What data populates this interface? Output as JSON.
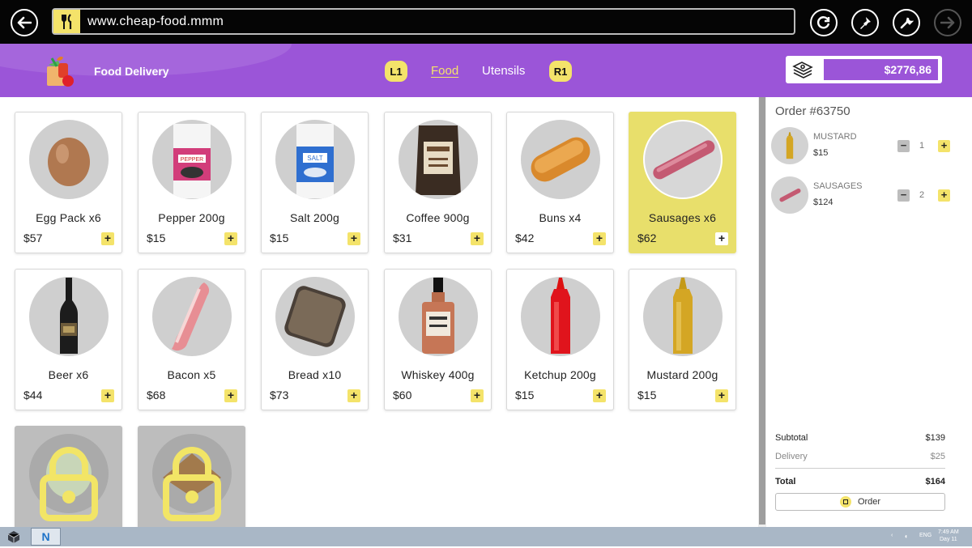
{
  "browser": {
    "url": "www.cheap-food.mmm"
  },
  "header": {
    "title": "Food Delivery",
    "left_key": "L1",
    "right_key": "R1",
    "tabs": [
      {
        "label": "Food",
        "active": true
      },
      {
        "label": "Utensils",
        "active": false
      }
    ],
    "balance": "$2776,86"
  },
  "products": [
    {
      "name": "Egg Pack x6",
      "price": "$57",
      "icon": "egg-icon"
    },
    {
      "name": "Pepper 200g",
      "price": "$15",
      "icon": "pepper-icon"
    },
    {
      "name": "Salt 200g",
      "price": "$15",
      "icon": "salt-icon"
    },
    {
      "name": "Coffee 900g",
      "price": "$31",
      "icon": "coffee-icon"
    },
    {
      "name": "Buns x4",
      "price": "$42",
      "icon": "bun-icon"
    },
    {
      "name": "Sausages x6",
      "price": "$62",
      "icon": "sausage-icon",
      "selected": true
    },
    {
      "name": "Beer x6",
      "price": "$44",
      "icon": "beer-icon"
    },
    {
      "name": "Bacon x5",
      "price": "$68",
      "icon": "bacon-icon"
    },
    {
      "name": "Bread x10",
      "price": "$73",
      "icon": "bread-icon"
    },
    {
      "name": "Whiskey 400g",
      "price": "$60",
      "icon": "whiskey-icon"
    },
    {
      "name": "Ketchup 200g",
      "price": "$15",
      "icon": "ketchup-icon"
    },
    {
      "name": "Mustard 200g",
      "price": "$15",
      "icon": "mustard-icon"
    }
  ],
  "locked_products": [
    {
      "icon": "lettuce-icon"
    },
    {
      "icon": "sandwich-icon"
    }
  ],
  "order": {
    "title": "Order #63750",
    "items": [
      {
        "name": "MUSTARD",
        "price": "$15",
        "qty": "1",
        "icon": "mustard-icon"
      },
      {
        "name": "SAUSAGES",
        "price": "$124",
        "qty": "2",
        "icon": "sausage-icon"
      }
    ],
    "subtotal_label": "Subtotal",
    "subtotal": "$139",
    "delivery_label": "Delivery",
    "delivery": "$25",
    "total_label": "Total",
    "total": "$164",
    "order_button": "Order"
  },
  "taskbar": {
    "app_letter": "N",
    "lang": "ENG",
    "time": "7:49 AM",
    "day": "Day 11"
  },
  "colors": {
    "purple": "#9b55d8",
    "yellow": "#f4e36a",
    "selected_card": "#e8df6b"
  }
}
